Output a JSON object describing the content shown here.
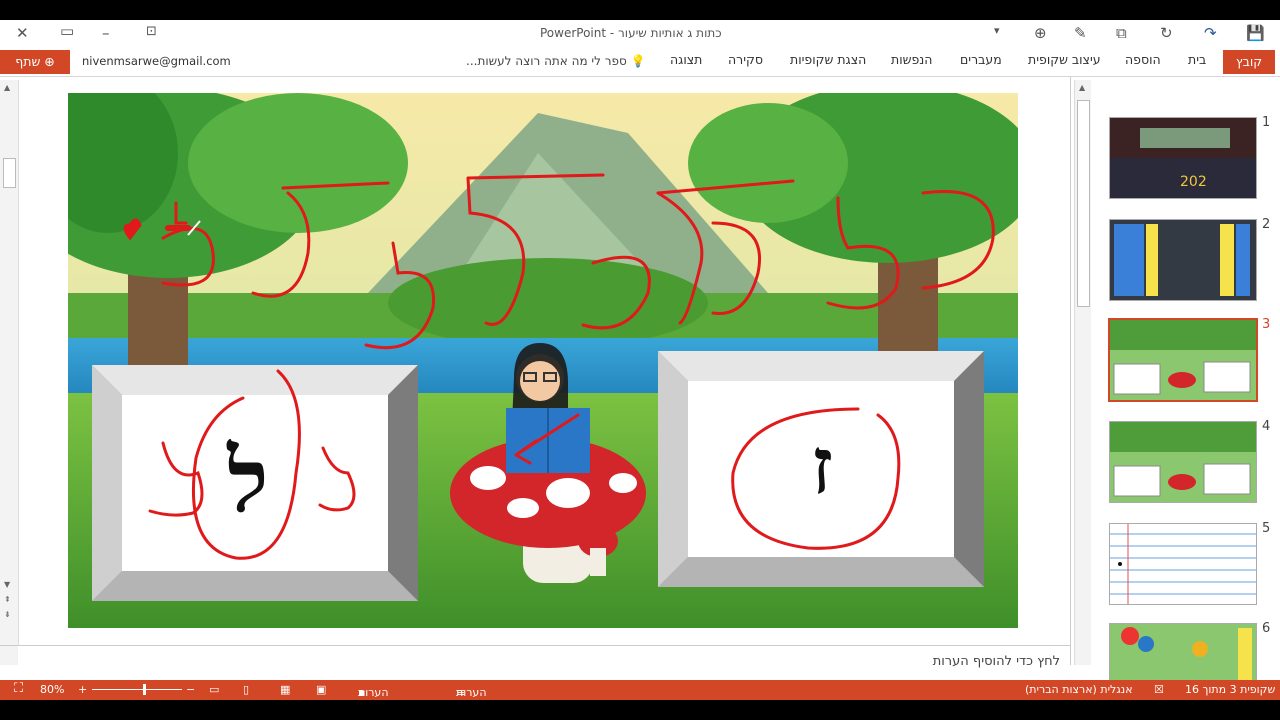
{
  "title": "כתות ג אותיות שיעור - PowerPoint",
  "ribbon": {
    "file_tab": "קובץ",
    "tabs": [
      "בית",
      "הוספה",
      "עיצוב שקופית",
      "מעברים",
      "הנפשות",
      "הצגת שקופיות",
      "סקירה",
      "תצוגה"
    ],
    "tell_me": "ספר לי מה אתה רוצה לעשות...",
    "email": "nivenmsarwe@gmail.com",
    "share": "שתף"
  },
  "slide": {
    "left_letter": "ל",
    "right_letter": "ז"
  },
  "notes": {
    "placeholder": "לחץ כדי להוסיף הערות"
  },
  "thumbnails": {
    "numbers": [
      "1",
      "2",
      "3",
      "4",
      "5",
      "6"
    ],
    "selected": "3"
  },
  "status": {
    "slide_count": "שקופית 3 מתוך 16",
    "language": "אנגלית (ארצות הברית)",
    "notes": "הערות",
    "comments": "הערות הסבר",
    "zoom": "80%"
  },
  "colors": {
    "accent": "#d24726",
    "ink": "#e0191b"
  }
}
